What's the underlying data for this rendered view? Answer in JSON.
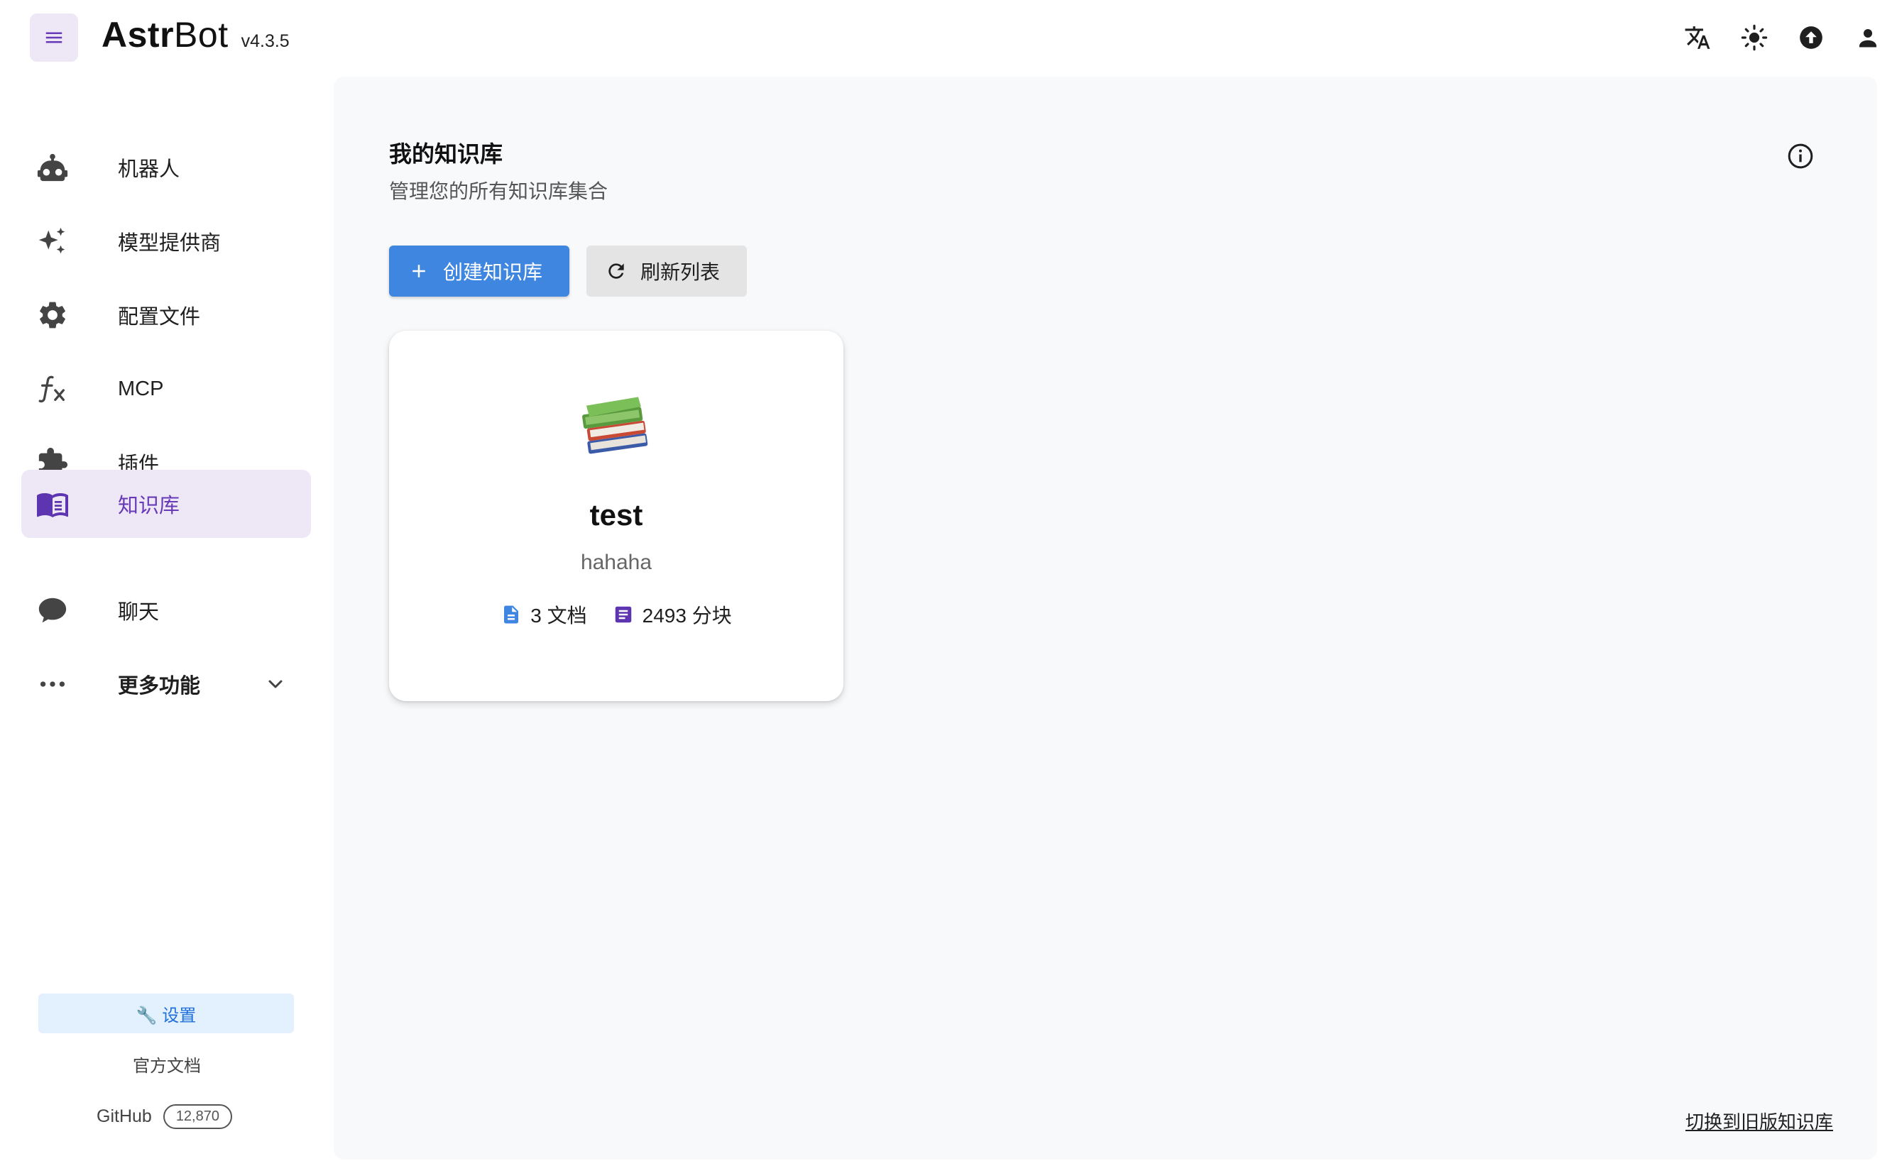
{
  "app": {
    "name_bold": "Astr",
    "name_rest": "Bot",
    "version": "v4.3.5"
  },
  "header": {
    "icons": [
      "translate-icon",
      "theme-light-icon",
      "update-icon",
      "account-icon"
    ]
  },
  "sidebar": {
    "items": [
      {
        "label": "机器人",
        "icon": "robot-icon"
      },
      {
        "label": "模型提供商",
        "icon": "sparkles-icon"
      },
      {
        "label": "配置文件",
        "icon": "gear-icon"
      },
      {
        "label": "MCP",
        "icon": "function-icon"
      },
      {
        "label": "插件",
        "icon": "puzzle-icon"
      },
      {
        "label": "知识库",
        "icon": "book-icon",
        "active": true
      },
      {
        "label": "聊天",
        "icon": "chat-icon"
      },
      {
        "label": "更多功能",
        "icon": "more-icon"
      }
    ],
    "settings_label": "🔧 设置",
    "docs_label": "官方文档",
    "github_label": "GitHub",
    "github_stars": "12,870"
  },
  "main": {
    "title": "我的知识库",
    "subtitle": "管理您的所有知识库集合",
    "create_label": "创建知识库",
    "refresh_label": "刷新列表",
    "switch_label": "切换到旧版知识库"
  },
  "knowledge_bases": [
    {
      "emoji": "📚",
      "name": "test",
      "description": "hahaha",
      "docs": "3 文档",
      "chunks": "2493 分块"
    }
  ],
  "colors": {
    "accent": "#673ab7",
    "active_bg": "#ede7f6",
    "primary_button": "#3f86e0",
    "settings_bg": "#e3f0fd",
    "doc_icon": "#3f86e0",
    "chunk_icon": "#5e35b1"
  }
}
